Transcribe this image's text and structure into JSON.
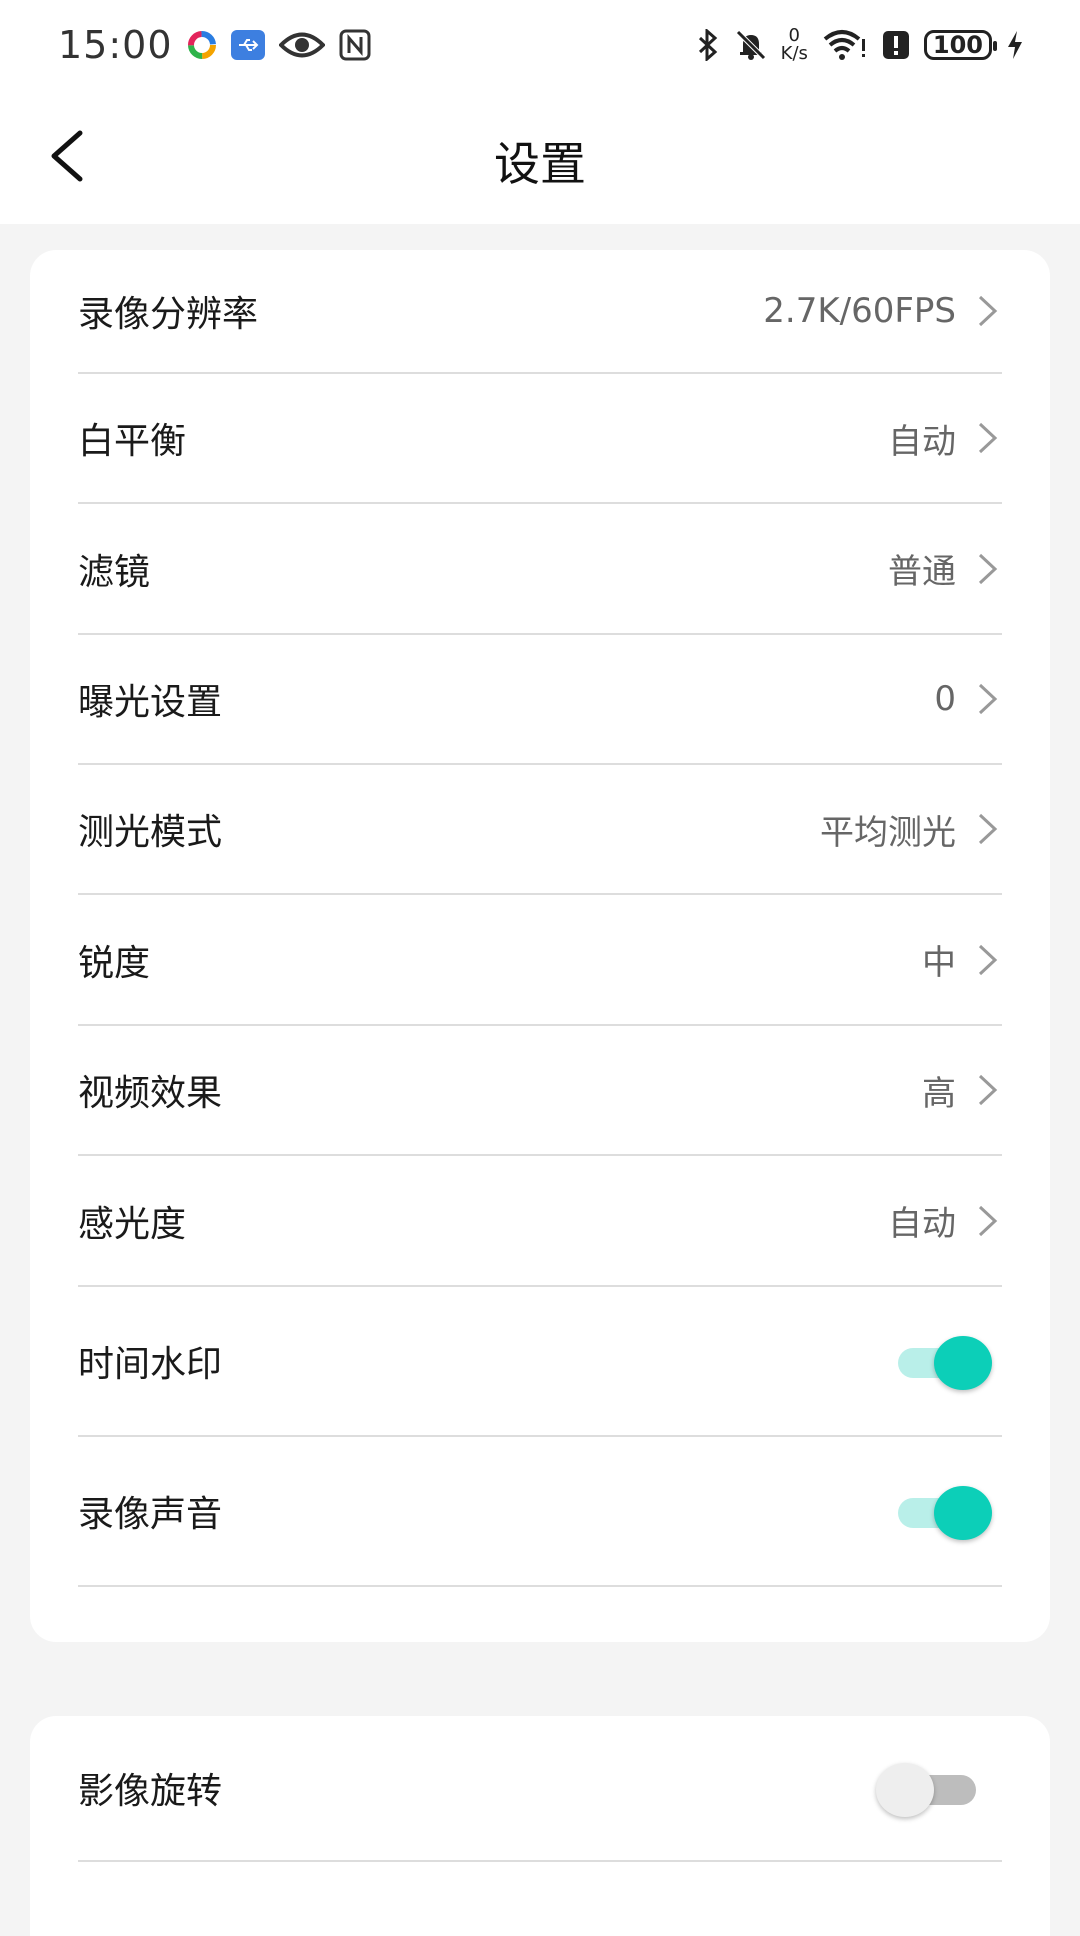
{
  "status_bar": {
    "time": "15:00",
    "netspeed_value": "0",
    "netspeed_unit": "K/s",
    "battery": "100",
    "icons_left": [
      "colorful-app-icon",
      "usb-icon",
      "eye-icon",
      "nfc-icon"
    ],
    "icons_right": [
      "bluetooth-icon",
      "bell-off-icon",
      "wifi-icon",
      "alert-icon",
      "battery-icon",
      "charging-icon"
    ]
  },
  "header": {
    "title": "设置",
    "back_icon": "chevron-left-icon"
  },
  "settings_group_1": {
    "items": [
      {
        "label": "录像分辨率",
        "value": "2.7K/60FPS",
        "type": "chevron"
      },
      {
        "label": "白平衡",
        "value": "自动",
        "type": "chevron"
      },
      {
        "label": "滤镜",
        "value": "普通",
        "type": "chevron"
      },
      {
        "label": "曝光设置",
        "value": "0",
        "type": "chevron"
      },
      {
        "label": "测光模式",
        "value": "平均测光",
        "type": "chevron"
      },
      {
        "label": "锐度",
        "value": "中",
        "type": "chevron"
      },
      {
        "label": "视频效果",
        "value": "高",
        "type": "chevron"
      },
      {
        "label": "感光度",
        "value": "自动",
        "type": "chevron"
      },
      {
        "label": "时间水印",
        "state": "on",
        "type": "toggle"
      },
      {
        "label": "录像声音",
        "state": "on",
        "type": "toggle"
      }
    ]
  },
  "settings_group_2": {
    "items": [
      {
        "label": "影像旋转",
        "state": "off",
        "type": "toggle"
      }
    ]
  },
  "colors": {
    "accent": "#0ccfb8",
    "accent_track": "#b9efe9",
    "background": "#f4f4f4",
    "card": "#ffffff"
  }
}
